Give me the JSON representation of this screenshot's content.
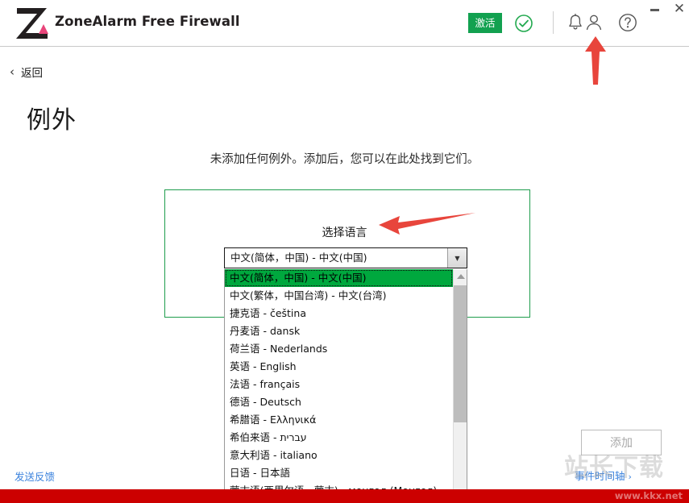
{
  "window": {
    "brand_title": "ZoneAlarm Free Firewall",
    "minimize_label": "–",
    "close_label": "✕"
  },
  "header": {
    "activate_label": "激活",
    "status_icon": "check-circle-icon",
    "bell_icon": "bell-icon",
    "account_icon": "person-icon",
    "help_icon": "question-circle-icon",
    "accent_green": "#12a150"
  },
  "nav": {
    "back_chevron": "‹",
    "back_label": "返回"
  },
  "page": {
    "title": "例外",
    "empty_message": "未添加任何例外。添加后，您可以在此处找到它们。"
  },
  "language_panel": {
    "label": "选择语言",
    "highlight_border_color": "#1f9d4d",
    "combo": {
      "value": "中文(简体，中国) - 中文(中国)",
      "arrow_icon": "chevron-down-icon"
    },
    "selected_index": 0,
    "selected_bg": "#00a83e",
    "options": [
      "中文(简体，中国) - 中文(中国)",
      "中文(繁体，中国台湾) - 中文(台湾)",
      "捷克语 - čeština",
      "丹麦语 - dansk",
      "荷兰语 - Nederlands",
      "英语 - English",
      "法语 - français",
      "德语 - Deutsch",
      "希腊语 - Ελληνικά",
      "希伯来语 - עברית",
      "意大利语 - italiano",
      "日语 - 日本語",
      "蒙古语(西里尔语、蒙古) - монгол (Монгол)"
    ],
    "scroll_up_icon": "triangle-up-icon"
  },
  "footer": {
    "add_label": "添加",
    "feedback_label": "发送反馈",
    "timeline_label": "事件时间轴",
    "timeline_chevron": "›",
    "link_color": "#3b82dd",
    "bottom_bar_color": "#cc0000"
  },
  "watermark": {
    "logo_text": "站长下载",
    "url": "www.kkx.net"
  },
  "annotations": {
    "arrow_color": "#e8453c",
    "arrow_up_target": "person-icon",
    "arrow_left_target": "select-language-label"
  }
}
